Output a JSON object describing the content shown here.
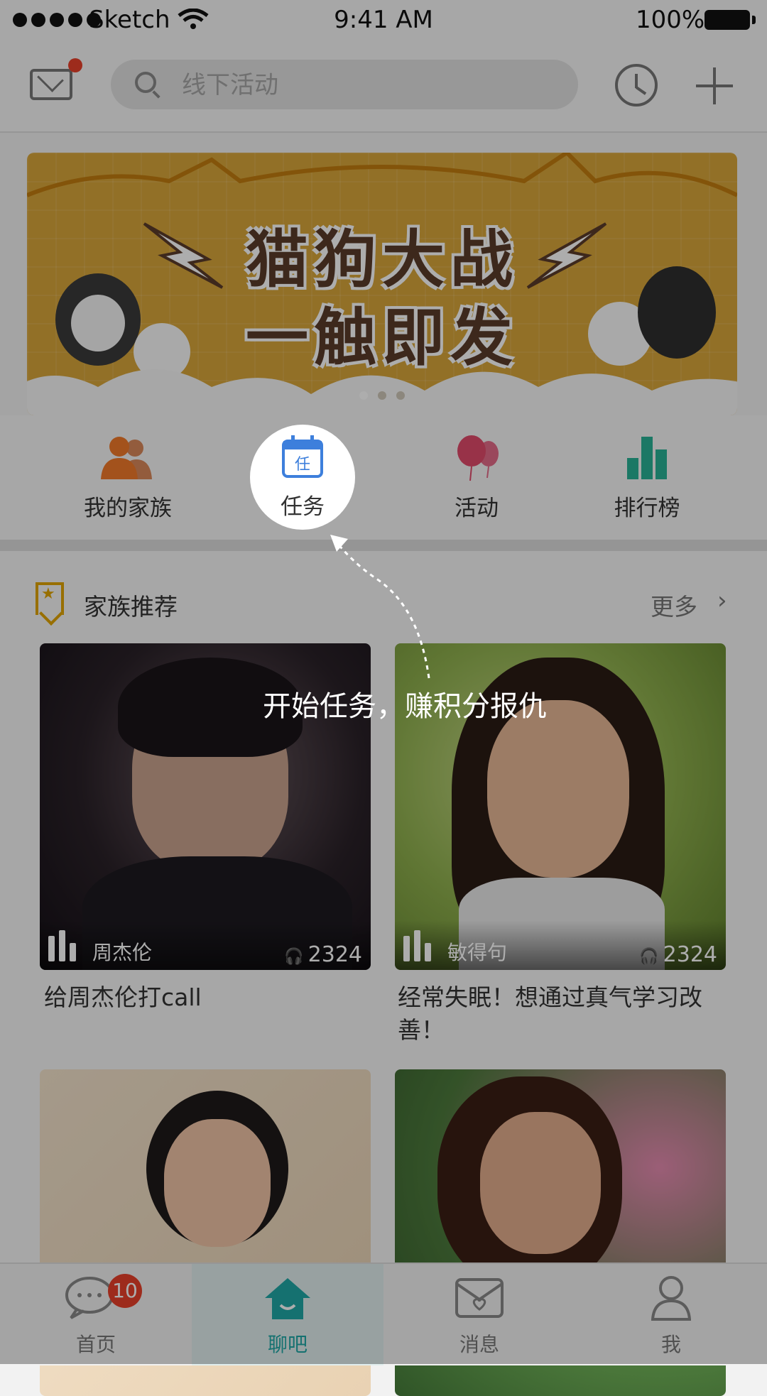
{
  "status_bar": {
    "carrier": "Sketch",
    "time": "9:41 AM",
    "battery": "100%"
  },
  "header": {
    "search_placeholder": "线下活动"
  },
  "banner": {
    "title_line1": "猫狗大战",
    "title_line2": "一触即发",
    "pages": 3,
    "active_page": 1
  },
  "quick_menu": [
    {
      "label": "我的家族",
      "icon": "family-icon",
      "color": "#f07a2a"
    },
    {
      "label": "任务",
      "icon": "task-calendar-icon",
      "color": "#3d7fdc"
    },
    {
      "label": "活动",
      "icon": "balloon-icon",
      "color": "#e04a6a"
    },
    {
      "label": "排行榜",
      "icon": "ranking-icon",
      "color": "#29b196"
    }
  ],
  "tip": {
    "text": "开始任务，赚积分报仇"
  },
  "section": {
    "title": "家族推荐",
    "more": "更多"
  },
  "cards": [
    {
      "name": "周杰伦",
      "count": "2324",
      "caption": "给周杰伦打call"
    },
    {
      "name": "敏得句",
      "count": "2324",
      "caption": "经常失眠！想通过真气学习改善！"
    },
    {
      "name": "",
      "count": "",
      "caption": ""
    },
    {
      "name": "",
      "count": "",
      "caption": ""
    }
  ],
  "tabbar": {
    "tabs": [
      {
        "label": "首页",
        "icon": "chat-bubble-icon"
      },
      {
        "label": "聊吧",
        "icon": "home-icon"
      },
      {
        "label": "消息",
        "icon": "envelope-heart-icon"
      },
      {
        "label": "我",
        "icon": "user-icon"
      }
    ],
    "badge": "10",
    "active": 1
  },
  "colors": {
    "accent": "#1fa7a5",
    "badge": "#e8402a",
    "banner": "#d7a53a"
  }
}
